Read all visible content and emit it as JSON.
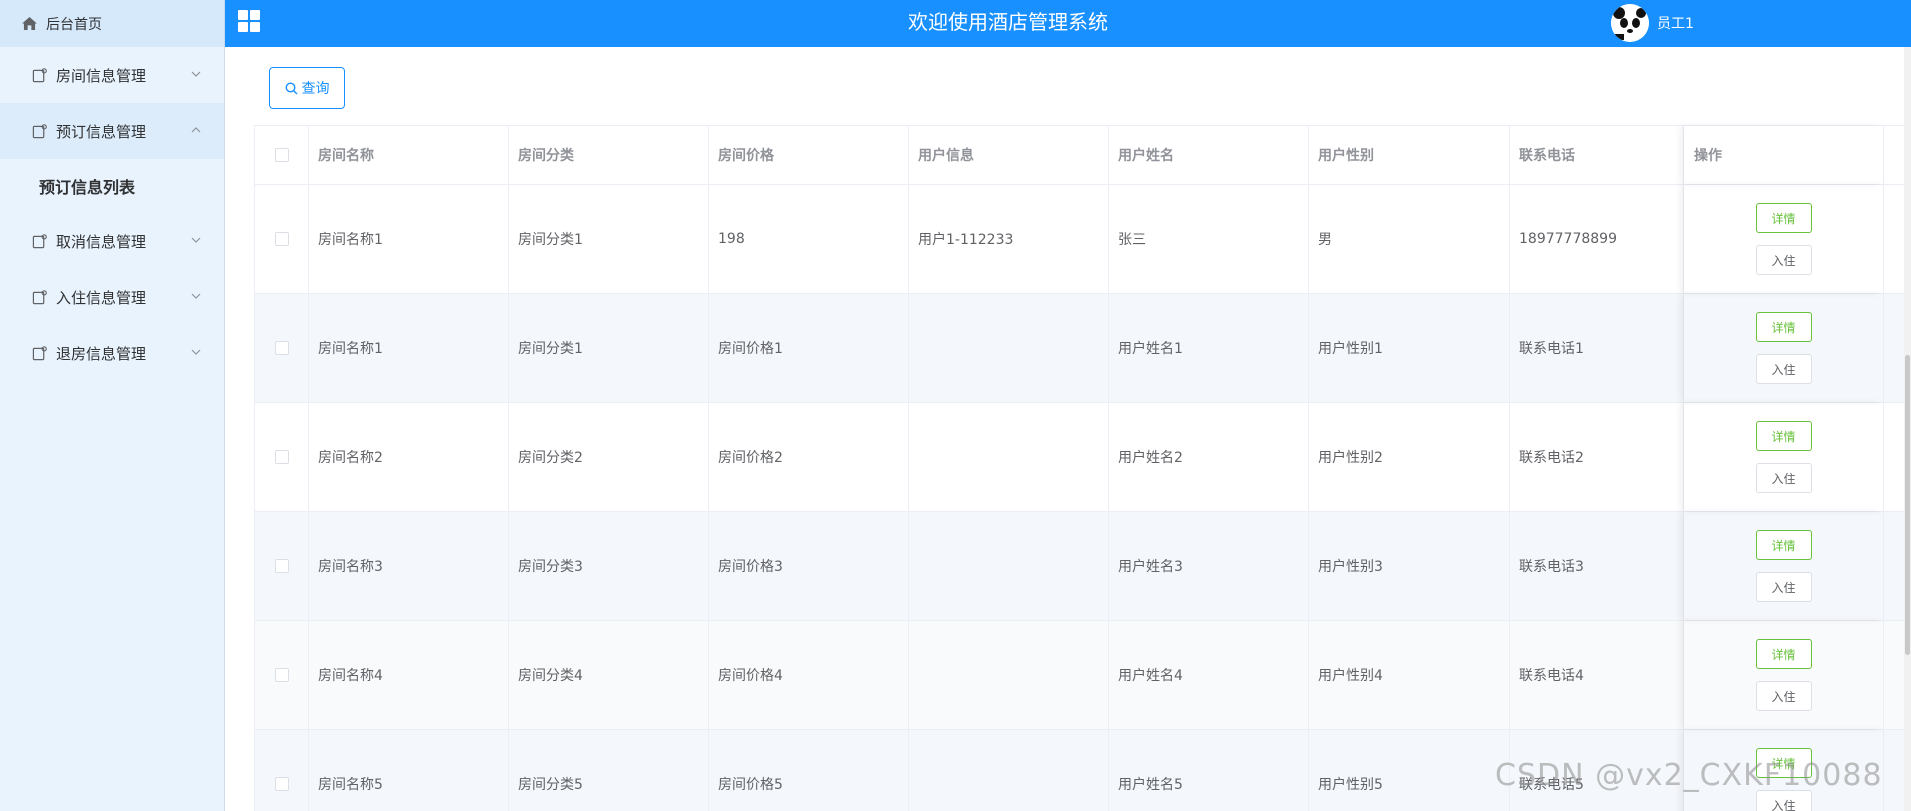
{
  "header": {
    "home_label": "后台首页",
    "system_title": "欢迎使用酒店管理系统",
    "user_name": "员工1"
  },
  "sidebar": {
    "items": [
      {
        "label": "房间信息管理",
        "open": false
      },
      {
        "label": "预订信息管理",
        "open": true
      },
      {
        "label": "取消信息管理",
        "open": false
      },
      {
        "label": "入住信息管理",
        "open": false
      },
      {
        "label": "退房信息管理",
        "open": false
      }
    ],
    "subitem_label": "预订信息列表"
  },
  "toolbar": {
    "search_label": "查询"
  },
  "table": {
    "columns": [
      "房间名称",
      "房间分类",
      "房间价格",
      "用户信息",
      "用户姓名",
      "用户性别",
      "联系电话",
      "操作"
    ],
    "rows": [
      {
        "name": "房间名称1",
        "category": "房间分类1",
        "price": "198",
        "user_info": "用户1-112233",
        "user_name": "张三",
        "gender": "男",
        "phone": "18977778899"
      },
      {
        "name": "房间名称1",
        "category": "房间分类1",
        "price": "房间价格1",
        "user_info": "",
        "user_name": "用户姓名1",
        "gender": "用户性别1",
        "phone": "联系电话1"
      },
      {
        "name": "房间名称2",
        "category": "房间分类2",
        "price": "房间价格2",
        "user_info": "",
        "user_name": "用户姓名2",
        "gender": "用户性别2",
        "phone": "联系电话2"
      },
      {
        "name": "房间名称3",
        "category": "房间分类3",
        "price": "房间价格3",
        "user_info": "",
        "user_name": "用户姓名3",
        "gender": "用户性别3",
        "phone": "联系电话3"
      },
      {
        "name": "房间名称4",
        "category": "房间分类4",
        "price": "房间价格4",
        "user_info": "",
        "user_name": "用户姓名4",
        "gender": "用户性别4",
        "phone": "联系电话4"
      },
      {
        "name": "房间名称5",
        "category": "房间分类5",
        "price": "房间价格5",
        "user_info": "",
        "user_name": "用户姓名5",
        "gender": "用户性别5",
        "phone": "联系电话5"
      }
    ],
    "detail_label": "详情",
    "checkin_label": "入住"
  },
  "watermark": "CSDN @vx2_CXKF10088",
  "colors": {
    "header_blue": "#1890ff",
    "sidebar_bg": "#e8f3fd",
    "detail_green": "#67c23a",
    "stripe": "#f4f7fb"
  }
}
